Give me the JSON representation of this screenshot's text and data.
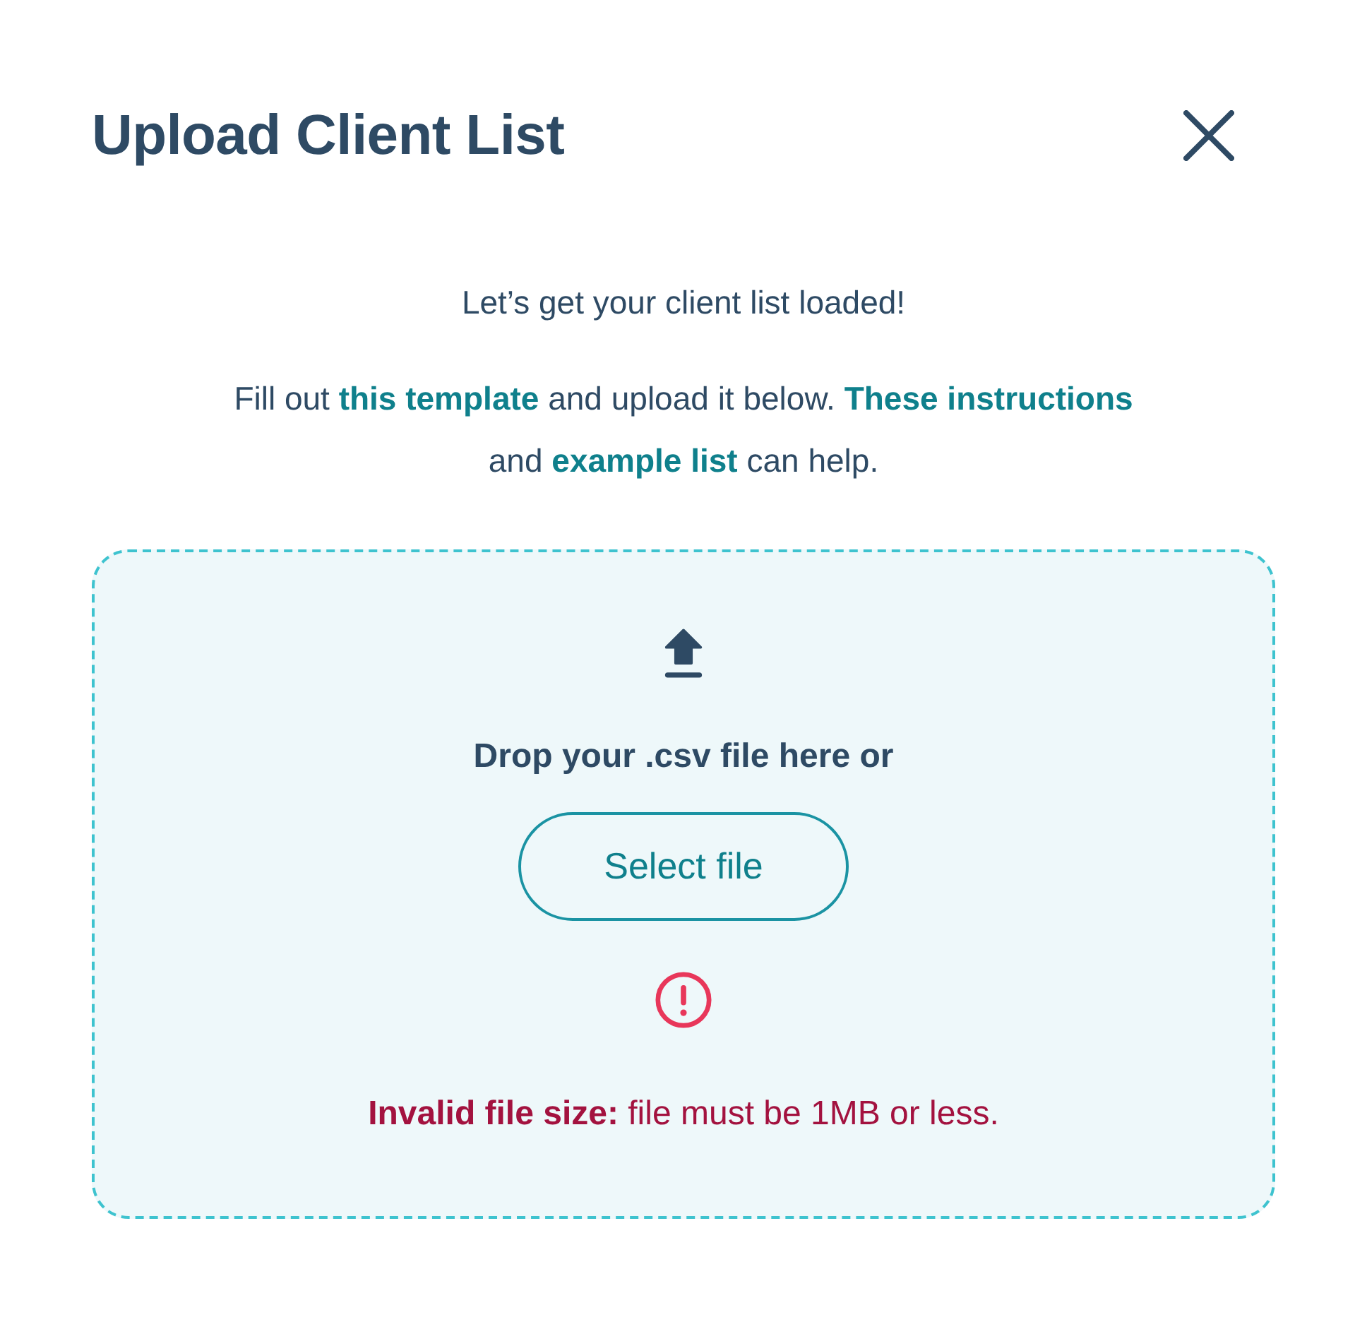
{
  "dialog": {
    "title": "Upload Client List"
  },
  "intro": {
    "heading": "Let’s get your client list loaded!",
    "paragraph": [
      {
        "kind": "text",
        "text": "Fill out "
      },
      {
        "kind": "link",
        "text": "this template"
      },
      {
        "kind": "text",
        "text": " and upload it below. "
      },
      {
        "kind": "link",
        "text": "These instructions"
      },
      {
        "kind": "text",
        "text": " and "
      },
      {
        "kind": "link",
        "text": "example list"
      },
      {
        "kind": "text",
        "text": " can help."
      }
    ]
  },
  "dropzone": {
    "prompt": "Drop your .csv file here or",
    "button": "Select file",
    "error": "**Invalid file size:** file must be 1MB or less."
  }
}
